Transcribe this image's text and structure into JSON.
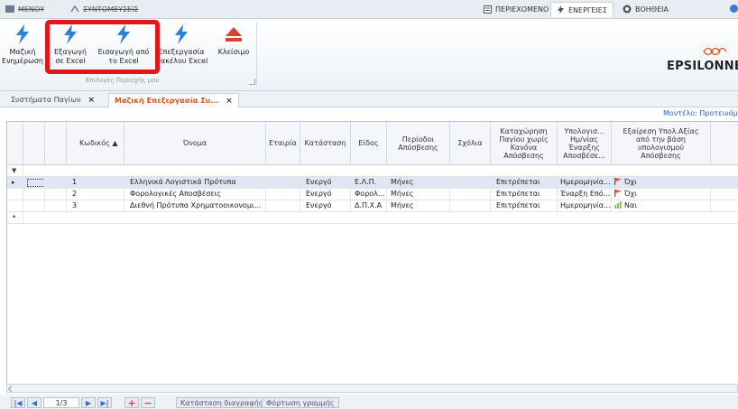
{
  "menubar": {
    "left_items": [
      "ΜΕΝΟΥ",
      "ΣΥΝΤΟΜΕΥΣΕΙΣ"
    ],
    "tabs": [
      {
        "label": "ΠΕΡΙΕΧΟΜΕΝΟ",
        "icon": "document-icon"
      },
      {
        "label": "ΕΝΕΡΓΕΙΕΣ",
        "icon": "lightning-icon",
        "active": true
      },
      {
        "label": "ΒΟΗΘΕΙΑ",
        "icon": "help-icon"
      }
    ]
  },
  "ribbon": {
    "buttons": [
      {
        "label": "Μαζική Ενημέρωση",
        "lines": [
          "Μαζική",
          "Ενημέρωση"
        ],
        "icon": "lightning-icon"
      },
      {
        "label": "Εξαγωγή σε Excel",
        "lines": [
          "Εξαγωγή",
          "σε Excel"
        ],
        "icon": "lightning-icon"
      },
      {
        "label": "Εισαγωγή από το Excel",
        "lines": [
          "Εισαγωγή από",
          "το Excel"
        ],
        "icon": "lightning-icon"
      },
      {
        "label": "Επεξεργασία Φακέλου Excel",
        "lines": [
          "Επεξεργασία",
          "Φακέλου Excel"
        ],
        "icon": "lightning-icon"
      },
      {
        "label": "Κλείσιμο",
        "lines": [
          "Κλείσιμο",
          ""
        ],
        "icon": "eject-icon"
      }
    ],
    "group_label": "Επιλογές Περιοχής μου"
  },
  "logo": {
    "text": "EPSILONNET"
  },
  "doc_tabs": [
    {
      "label": "Συστήματα Παγίων",
      "active": false
    },
    {
      "label": "Μαζική Επεξεργασία Συ...",
      "active": true
    }
  ],
  "model_label": "Μοντέλο: Προτεινόμενο",
  "grid": {
    "columns": [
      {
        "label": "Κωδικός ▲"
      },
      {
        "label": "Όνομα"
      },
      {
        "label": "Εταιρία"
      },
      {
        "label": "Κατάσταση"
      },
      {
        "label": "Είδος"
      },
      {
        "label": "Περίοδοι Απόσβεσης"
      },
      {
        "label": "Σχόλια"
      },
      {
        "label": "Καταχώρηση Παγίου χωρίς Κανόνα Απόσβεσης"
      },
      {
        "label": "Υπολογισ... Ημ/νίας Έναρξης Αποσβέσε..."
      },
      {
        "label": "Εξαίρεση Υπολ.Αξίας από την βάση υπολογισμού Απόσβεσης"
      }
    ],
    "rows": [
      {
        "code": "1",
        "name": "Ελληνικά Λογιστικά Πρότυπα",
        "company": "",
        "status": "Ενεργό",
        "type": "Ε.Λ.Π.",
        "periods": "Μήνες",
        "comments": "",
        "no_rule": "Επιτρέπεται",
        "start_calc": "Ημερομηνία...",
        "exclusion": "Όχι",
        "exclusion_icon": "red-flag-icon"
      },
      {
        "code": "2",
        "name": "Φορολογικές Αποσβέσεις",
        "company": "",
        "status": "Ενεργό",
        "type": "Φορολ...",
        "periods": "Μήνες",
        "comments": "",
        "no_rule": "Επιτρέπεται",
        "start_calc": "Έναρξη Επό...",
        "exclusion": "Όχι",
        "exclusion_icon": "red-flag-icon"
      },
      {
        "code": "3",
        "name": "Διεθνή Πρότυπα Χρηματοοικονομι...",
        "company": "",
        "status": "Ενεργό",
        "type": "Δ.Π.Χ.Α",
        "periods": "Μήνες",
        "comments": "",
        "no_rule": "Επιτρέπεται",
        "start_calc": "Ημερομηνία...",
        "exclusion": "Ναι",
        "exclusion_icon": "green-bars-icon"
      }
    ]
  },
  "footer": {
    "page_value": "1/3",
    "delete_state_label": "Κατάσταση διαγραφής",
    "load_row_label": "Φόρτωση γραμμής"
  },
  "colors": {
    "highlight": "#e3141b",
    "accent": "#d9531e",
    "link": "#2a5bd7",
    "icon_blue": "#2f7fd6"
  }
}
